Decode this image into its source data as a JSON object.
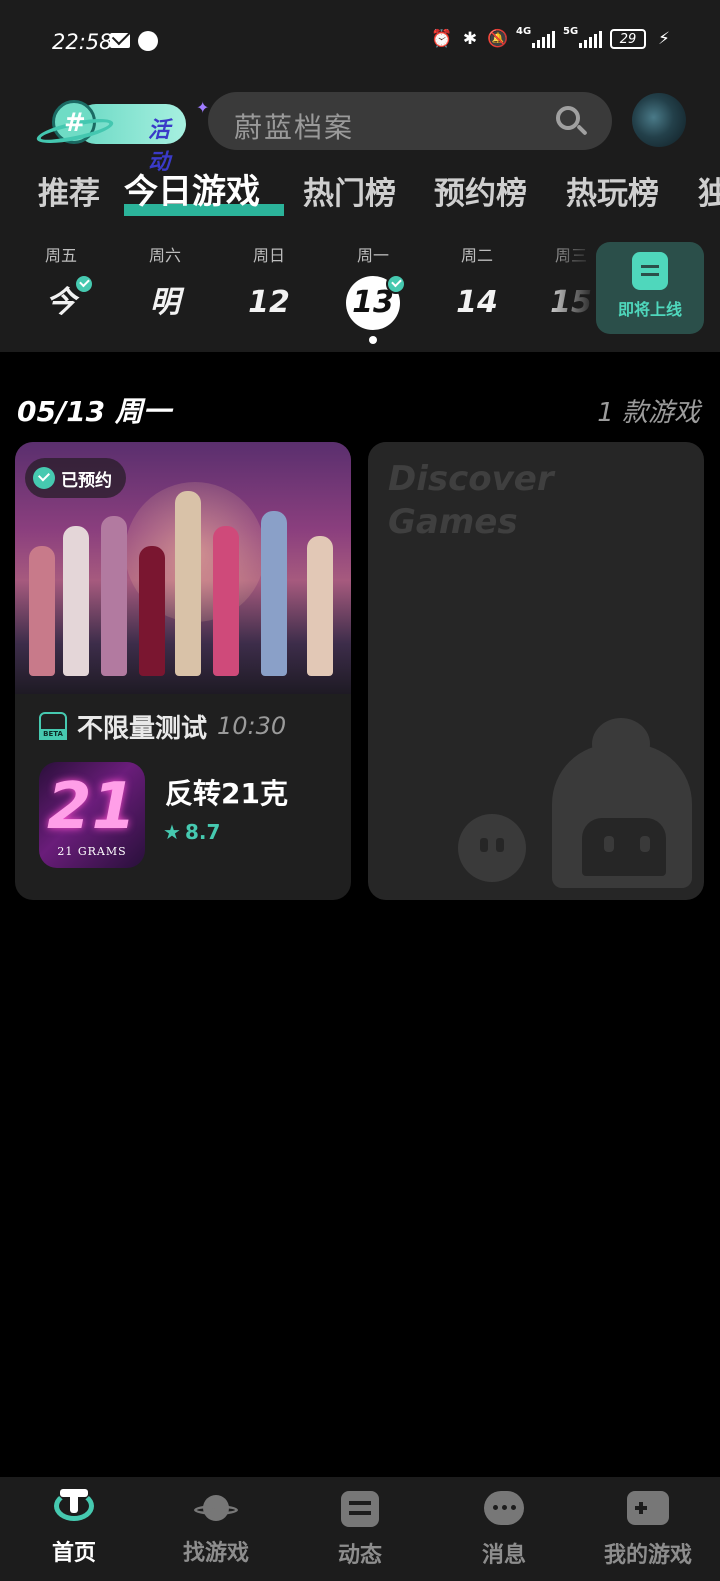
{
  "status_bar": {
    "time": "22:58",
    "network_4g": "4G",
    "network_5g": "5G",
    "battery": "29"
  },
  "header": {
    "activity_label": "活动",
    "search_placeholder": "蔚蓝档案",
    "tabs": [
      "推荐",
      "今日游戏",
      "热门榜",
      "预约榜",
      "热玩榜",
      "独"
    ],
    "active_tab": "今日游戏"
  },
  "calendar": {
    "days": [
      {
        "week": "周五",
        "label": "今",
        "checked": true
      },
      {
        "week": "周六",
        "label": "明",
        "checked": false
      },
      {
        "week": "周日",
        "label": "12",
        "checked": false
      },
      {
        "week": "周一",
        "label": "13",
        "checked": true,
        "selected": true
      },
      {
        "week": "周二",
        "label": "14",
        "checked": false
      },
      {
        "week": "周三",
        "label": "15",
        "checked": false
      }
    ],
    "upcoming_label": "即将上线"
  },
  "content": {
    "date_label": "05/13 周一",
    "count_label": "1 款游戏",
    "game_card": {
      "reserved_label": "已预约",
      "test_type": "不限量测试",
      "test_time": "10:30",
      "icon_number": "21",
      "icon_subtitle": "21 GRAMS",
      "name": "反转21克",
      "rating": "8.7"
    },
    "discover_card": {
      "text": "Discover\nGames"
    }
  },
  "bottom_nav": [
    {
      "label": "首页",
      "icon": "home-icon",
      "active": true
    },
    {
      "label": "找游戏",
      "icon": "planet-icon",
      "active": false
    },
    {
      "label": "动态",
      "icon": "feed-icon",
      "active": false
    },
    {
      "label": "消息",
      "icon": "message-icon",
      "active": false
    },
    {
      "label": "我的游戏",
      "icon": "gamepad-icon",
      "active": false
    }
  ],
  "colors": {
    "accent": "#46c9b0",
    "background": "#000000",
    "surface": "#1c1c1c"
  }
}
